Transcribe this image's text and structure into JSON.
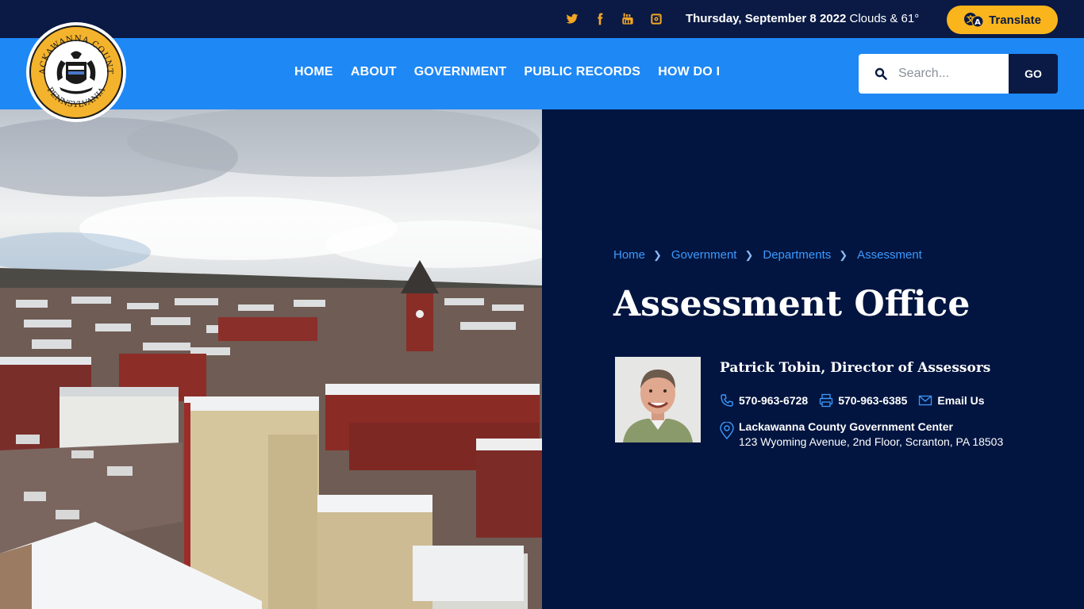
{
  "social": {
    "icons": [
      "twitter-icon",
      "facebook-icon",
      "youtube-icon",
      "instagram-icon"
    ],
    "color": "#f5a623"
  },
  "topbar": {
    "date": "Thursday, September 8 2022",
    "weather": "Clouds & 61°",
    "translate_label": "Translate"
  },
  "header": {
    "seal_text_top": "LACKAWANNA COUNTY",
    "seal_text_bottom": "PENNSYLVANIA"
  },
  "nav": {
    "items": [
      "HOME",
      "ABOUT",
      "GOVERNMENT",
      "PUBLIC RECORDS",
      "HOW DO I"
    ]
  },
  "search": {
    "placeholder": "Search...",
    "go_label": "GO"
  },
  "breadcrumb": [
    "Home",
    "Government",
    "Departments",
    "Assessment"
  ],
  "page": {
    "title": "Assessment Office"
  },
  "director": {
    "name_title": "Patrick Tobin, Director of Assessors",
    "phone": "570-963-6728",
    "fax": "570-963-6385",
    "email_label": "Email Us",
    "location_name": "Lackawanna County Government Center",
    "location_address": "123 Wyoming Avenue, 2nd Floor, Scranton, PA 18503"
  },
  "colors": {
    "topbar": "#0a1a44",
    "navbar": "#1e88f5",
    "panel": "#021540",
    "accent": "#fbb51c",
    "link": "#3c9aff"
  }
}
